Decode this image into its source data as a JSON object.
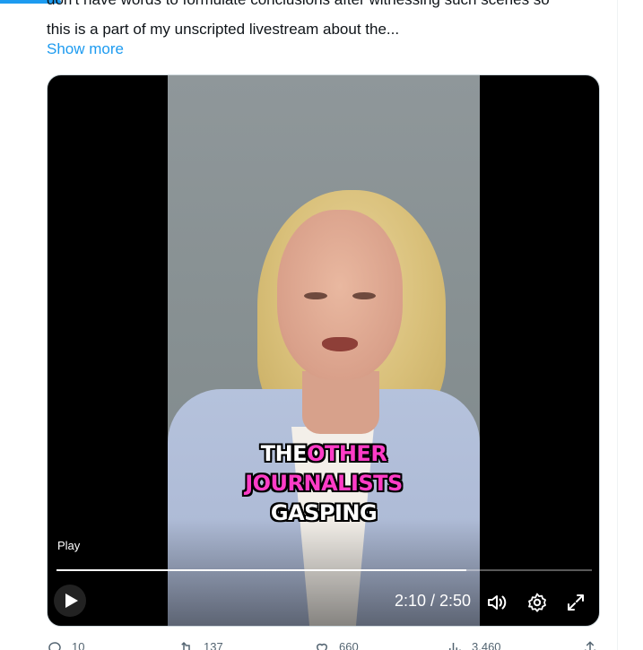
{
  "tweet": {
    "text_line1": "don't have words to formulate conclusions after witnessing such scenes so",
    "text_line2": "this is a part of my unscripted livestream about the...",
    "show_more": "Show more"
  },
  "video": {
    "caption_the": "THE",
    "caption_other": "OTHER",
    "caption_journalists": "JOURNALISTS",
    "caption_gasping": "GASPING",
    "play_tooltip": "Play",
    "time": "2:10 / 2:50",
    "progress_fraction": 0.765
  },
  "actions": {
    "replies": "10",
    "reposts": "137",
    "likes": "660",
    "views": "3,460"
  },
  "colors": {
    "accent": "#1d9bf0",
    "caption_pink": "#ff3cc7",
    "text": "#0f1419",
    "muted": "#536471"
  },
  "icons": [
    "play-icon",
    "volume-icon",
    "settings-icon",
    "fullscreen-icon",
    "reply-icon",
    "repost-icon",
    "like-icon",
    "views-icon",
    "share-icon"
  ]
}
